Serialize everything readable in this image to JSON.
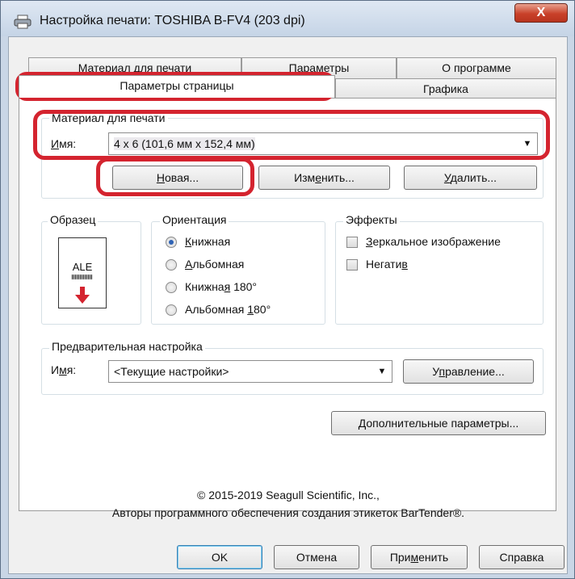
{
  "window": {
    "title": "Настройка печати: TOSHIBA B-FV4 (203 dpi)",
    "close_label": "X"
  },
  "tabs": {
    "row_back": [
      "Материал для печати",
      "Параметры",
      "О программе"
    ],
    "row_front": [
      "Параметры страницы",
      "Графика"
    ],
    "active": "Параметры страницы"
  },
  "media": {
    "group_label": "Материал для печати",
    "name_label": "Имя:",
    "name_value": "4 x 6 (101,6 мм x 152,4 мм)",
    "buttons": {
      "new": "Новая...",
      "edit": "Изменить...",
      "delete": "Удалить..."
    }
  },
  "sample": {
    "group_label": "Образец",
    "preview_text": "ALE"
  },
  "orientation": {
    "group_label": "Ориентация",
    "options": [
      "Книжная",
      "Альбомная",
      "Книжная 180°",
      "Альбомная 180°"
    ],
    "selected_index": 0
  },
  "effects": {
    "group_label": "Эффекты",
    "options": [
      {
        "label": "Зеркальное изображение",
        "checked": false
      },
      {
        "label": "Негатив",
        "checked": false
      }
    ]
  },
  "preset": {
    "group_label": "Предварительная настройка",
    "name_label": "Имя:",
    "name_value": "<Текущие настройки>",
    "manage_button": "Управление..."
  },
  "advanced_button": "Дополнительные параметры...",
  "copyright": {
    "line1": "© 2015-2019 Seagull Scientific, Inc.,",
    "line2": "Авторы программного обеспечения создания этикеток BarTender®."
  },
  "footer_buttons": {
    "ok": "OK",
    "cancel": "Отмена",
    "apply": "Применить",
    "help": "Справка"
  },
  "colors": {
    "highlight_red": "#d4242f",
    "radio_selected": "#2f63b4",
    "sample_arrow": "#d4242f"
  }
}
